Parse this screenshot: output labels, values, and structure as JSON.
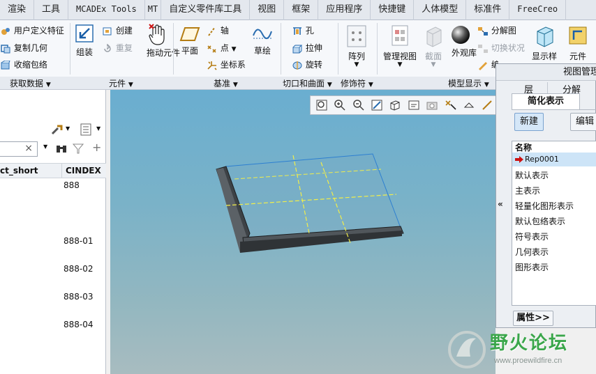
{
  "tabs": [
    "渲染",
    "工具",
    "MCADEx Tools",
    "MT",
    "自定义零件库工具",
    "视图",
    "框架",
    "应用程序",
    "快捷键",
    "人体模型",
    "标准件",
    "FreeCreo"
  ],
  "ribbon": {
    "get_data": {
      "user_feature": "用户定义特征",
      "copy_geom": "复制几何",
      "shrinkwrap": "收缩包络"
    },
    "component": {
      "assemble": "组装",
      "create": "创建",
      "repeat": "重复",
      "drag": "拖动元件"
    },
    "datum": {
      "plane": "平面",
      "axis": "轴",
      "point": "点",
      "csys": "坐标系",
      "sketch": "草绘"
    },
    "cut": {
      "hole": "孔",
      "extrude": "拉伸",
      "revolve": "旋转"
    },
    "modifiers": {
      "pattern": "阵列"
    },
    "model_display": {
      "manage_views": "管理视图",
      "section": "截面",
      "appearance": "外观库",
      "explode": "分解图",
      "toggle_state": "切换状况",
      "edit_position": "编辑位置",
      "display_style": "显示样",
      "component_label": "元件"
    }
  },
  "groups": {
    "get_data": "获取数据",
    "component": "元件",
    "datum": "基准",
    "cut_surface": "切口和曲面",
    "modifiers": "修饰符",
    "model_display": "模型显示"
  },
  "left_panel": {
    "col_name": "ct_short",
    "col_index": "CINDEX",
    "rows": [
      "888",
      "888-01",
      "888-02",
      "888-03",
      "888-04"
    ],
    "clear": "×"
  },
  "dialog": {
    "title": "视图管理",
    "tabs": [
      "层",
      "分解"
    ],
    "active_tab": "简化表示",
    "new_btn": "新建",
    "edit_btn": "编辑",
    "list_header": "名称",
    "items": [
      "Rep0001",
      "默认表示",
      "主表示",
      "轻量化图形表示",
      "默认包络表示",
      "符号表示",
      "几何表示",
      "图形表示"
    ],
    "props_btn": "属性>>",
    "collapse": "«"
  },
  "watermark": {
    "text": "野火论坛",
    "url": "www.proewildfire.cn"
  },
  "colors": {
    "accent": "#2a6db0",
    "selected_row": "#cde4f7",
    "highlight_arrow": "#cc1111",
    "wm_green": "#3aa64a"
  }
}
